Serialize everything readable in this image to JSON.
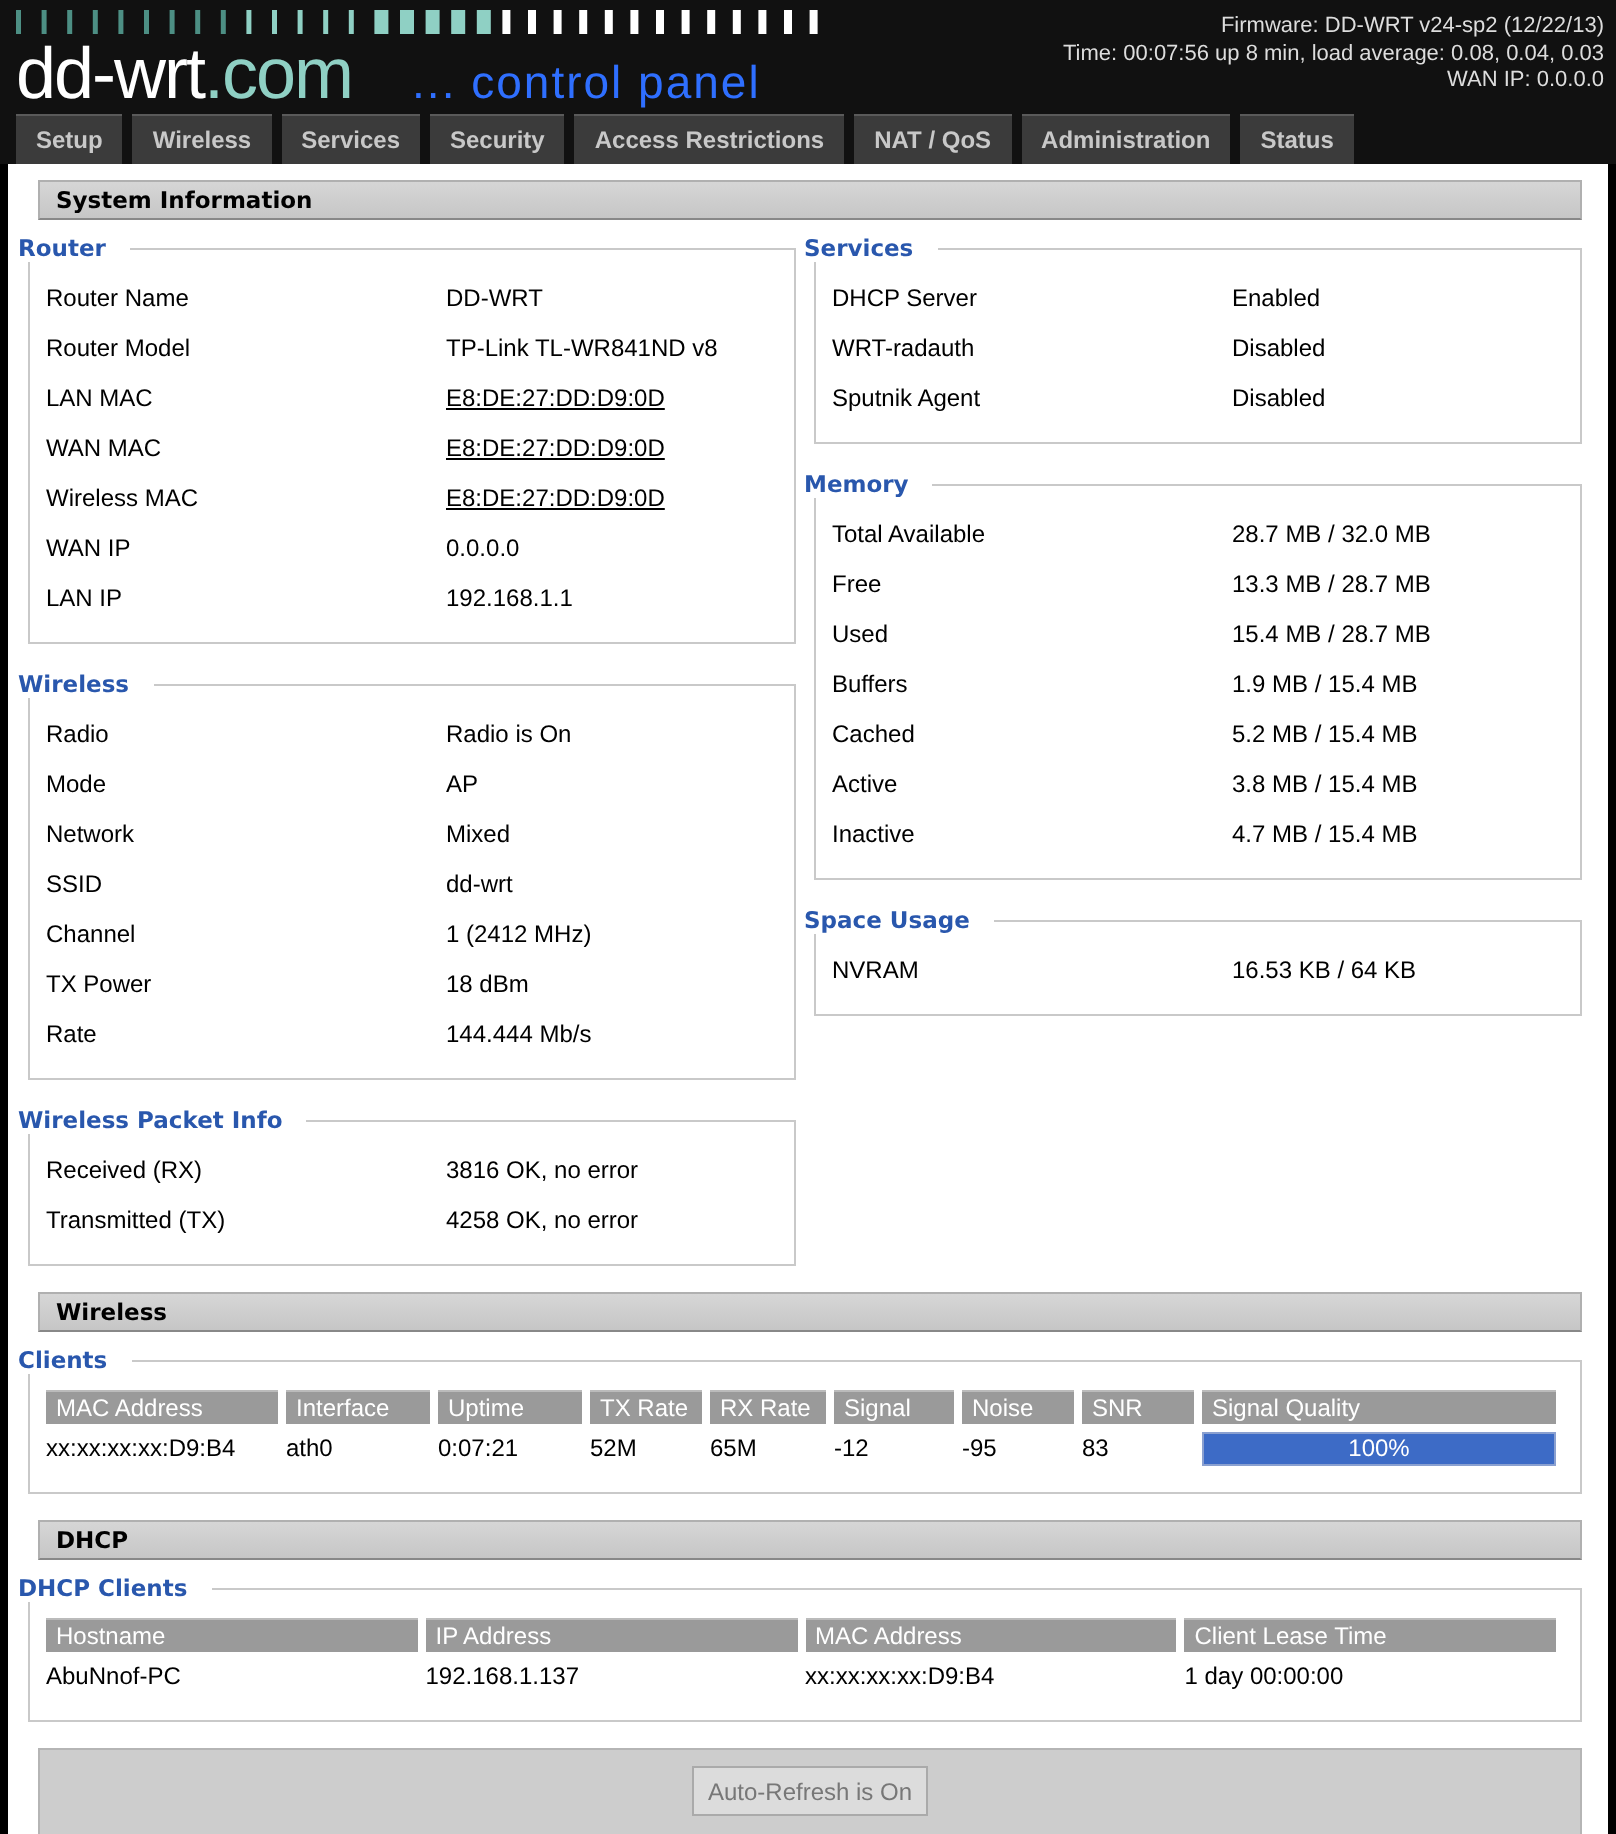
{
  "header": {
    "logo_name": "dd-wrt",
    "logo_domain": ".com",
    "tagline": "... control panel",
    "firmware": "Firmware: DD-WRT v24-sp2 (12/22/13)",
    "uptime": "Time: 00:07:56 up 8 min, load average: 0.08, 0.04, 0.03",
    "wan_ip": "WAN IP: 0.0.0.0"
  },
  "tabs": [
    {
      "label": "Setup",
      "selected": false
    },
    {
      "label": "Wireless",
      "selected": false
    },
    {
      "label": "Services",
      "selected": false
    },
    {
      "label": "Security",
      "selected": false
    },
    {
      "label": "Access Restrictions",
      "selected": false
    },
    {
      "label": "NAT / QoS",
      "selected": false
    },
    {
      "label": "Administration",
      "selected": false
    },
    {
      "label": "Status",
      "selected": false
    }
  ],
  "system_information": {
    "title": "System Information",
    "left": [
      {
        "legend": "Router",
        "rows": [
          {
            "label": "Router Name",
            "value": "DD-WRT",
            "link": false
          },
          {
            "label": "Router Model",
            "value": "TP-Link TL-WR841ND v8",
            "link": false
          },
          {
            "label": "LAN MAC",
            "value": "E8:DE:27:DD:D9:0D",
            "link": true
          },
          {
            "label": "WAN MAC",
            "value": "E8:DE:27:DD:D9:0D",
            "link": true
          },
          {
            "label": "Wireless MAC",
            "value": "E8:DE:27:DD:D9:0D",
            "link": true
          },
          {
            "label": "WAN IP",
            "value": "0.0.0.0",
            "link": false
          },
          {
            "label": "LAN IP",
            "value": "192.168.1.1",
            "link": false
          }
        ]
      },
      {
        "legend": "Wireless",
        "rows": [
          {
            "label": "Radio",
            "value": "Radio is On",
            "link": false
          },
          {
            "label": "Mode",
            "value": "AP",
            "link": false
          },
          {
            "label": "Network",
            "value": "Mixed",
            "link": false
          },
          {
            "label": "SSID",
            "value": "dd-wrt",
            "link": false
          },
          {
            "label": "Channel",
            "value": "1 (2412 MHz)",
            "link": false
          },
          {
            "label": "TX Power",
            "value": "18 dBm",
            "link": false
          },
          {
            "label": "Rate",
            "value": "144.444 Mb/s",
            "link": false
          }
        ]
      },
      {
        "legend": "Wireless Packet Info",
        "rows": [
          {
            "label": "Received (RX)",
            "value": "3816 OK, no error",
            "link": false
          },
          {
            "label": "Transmitted (TX)",
            "value": "4258 OK, no error",
            "link": false
          }
        ]
      }
    ],
    "right": [
      {
        "legend": "Services",
        "rows": [
          {
            "label": "DHCP Server",
            "value": "Enabled",
            "link": false
          },
          {
            "label": "WRT-radauth",
            "value": "Disabled",
            "link": false
          },
          {
            "label": "Sputnik Agent",
            "value": "Disabled",
            "link": false
          }
        ]
      },
      {
        "legend": "Memory",
        "rows": [
          {
            "label": "Total Available",
            "value": "28.7 MB / 32.0 MB",
            "link": false
          },
          {
            "label": "Free",
            "value": "13.3 MB / 28.7 MB",
            "link": false
          },
          {
            "label": "Used",
            "value": "15.4 MB / 28.7 MB",
            "link": false
          },
          {
            "label": "Buffers",
            "value": "1.9 MB / 15.4 MB",
            "link": false
          },
          {
            "label": "Cached",
            "value": "5.2 MB / 15.4 MB",
            "link": false
          },
          {
            "label": "Active",
            "value": "3.8 MB / 15.4 MB",
            "link": false
          },
          {
            "label": "Inactive",
            "value": "4.7 MB / 15.4 MB",
            "link": false
          }
        ]
      },
      {
        "legend": "Space Usage",
        "rows": [
          {
            "label": "NVRAM",
            "value": "16.53 KB / 64 KB",
            "link": false
          }
        ]
      }
    ]
  },
  "wireless": {
    "title": "Wireless",
    "clients": {
      "legend": "Clients",
      "columns": [
        "MAC Address",
        "Interface",
        "Uptime",
        "TX Rate",
        "RX Rate",
        "Signal",
        "Noise",
        "SNR",
        "Signal Quality"
      ],
      "rows": [
        {
          "cells": [
            "xx:xx:xx:xx:D9:B4",
            "ath0",
            "0:07:21",
            "52M",
            "65M",
            "-12",
            "-95",
            "83"
          ],
          "signal_quality": {
            "level": 1.0,
            "text": "100%"
          }
        }
      ]
    }
  },
  "dhcp": {
    "title": "DHCP",
    "clients": {
      "legend": "DHCP Clients",
      "columns": [
        "Hostname",
        "IP Address",
        "MAC Address",
        "Client Lease Time"
      ],
      "rows": [
        {
          "cells": [
            "AbuNnof-PC",
            "192.168.1.137",
            "xx:xx:xx:xx:D9:B4",
            "1 day 00:00:00"
          ]
        }
      ]
    }
  },
  "refresh_button": {
    "label": "Auto-Refresh is On",
    "disabled": true
  }
}
